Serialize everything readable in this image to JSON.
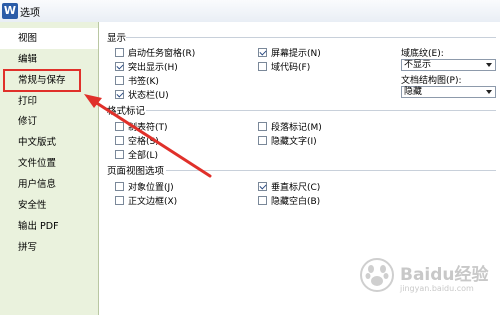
{
  "window": {
    "title": "选项",
    "app_icon_letter": "W"
  },
  "sidebar": {
    "items": [
      {
        "label": "视图",
        "active": true
      },
      {
        "label": "编辑"
      },
      {
        "label": "常规与保存",
        "highlighted": true
      },
      {
        "label": "打印"
      },
      {
        "label": "修订"
      },
      {
        "label": "中文版式"
      },
      {
        "label": "文件位置"
      },
      {
        "label": "用户信息"
      },
      {
        "label": "安全性"
      },
      {
        "label": "输出 PDF"
      },
      {
        "label": "拼写"
      }
    ]
  },
  "display": {
    "title": "显示",
    "col1": [
      {
        "label": "启动任务窗格(R)",
        "checked": false
      },
      {
        "label": "突出显示(H)",
        "checked": true
      },
      {
        "label": "书签(K)",
        "checked": false
      },
      {
        "label": "状态栏(U)",
        "checked": true
      }
    ],
    "col2": [
      {
        "label": "屏幕提示(N)",
        "checked": true
      },
      {
        "label": "域代码(F)",
        "checked": false
      }
    ],
    "underline_label": "域底纹(E):",
    "underline_value": "不显示",
    "docmap_label": "文档结构图(P):",
    "docmap_value": "隐藏"
  },
  "format_marks": {
    "title": "格式标记",
    "col1": [
      {
        "label": "制表符(T)",
        "checked": false
      },
      {
        "label": "空格(S)",
        "checked": false
      },
      {
        "label": "全部(L)",
        "checked": false
      }
    ],
    "col2": [
      {
        "label": "段落标记(M)",
        "checked": false
      },
      {
        "label": "隐藏文字(I)",
        "checked": false
      }
    ]
  },
  "page_view": {
    "title": "页面视图选项",
    "col1": [
      {
        "label": "对象位置(J)",
        "checked": false
      },
      {
        "label": "正文边框(X)",
        "checked": false
      }
    ],
    "col2": [
      {
        "label": "垂直标尺(C)",
        "checked": true
      },
      {
        "label": "隐藏空白(B)",
        "checked": false
      }
    ]
  },
  "watermark": {
    "brand": "Baidu经验",
    "url": "jingyan.baidu.com"
  },
  "colors": {
    "sidebar_bg": "#eaf2dd",
    "highlight": "#e0302a"
  }
}
